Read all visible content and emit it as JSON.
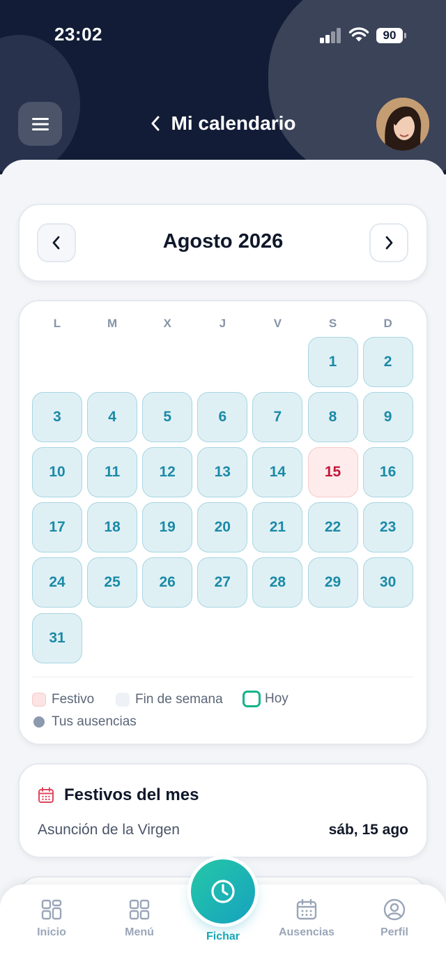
{
  "status_bar": {
    "time": "23:02",
    "battery": "90"
  },
  "header": {
    "title": "Mi calendario"
  },
  "calendar": {
    "month_label": "Agosto 2026",
    "weekdays": [
      "L",
      "M",
      "X",
      "J",
      "V",
      "S",
      "D"
    ],
    "first_weekday_index": 5,
    "days_in_month": 31,
    "holidays": [
      15
    ]
  },
  "legend": {
    "festivo": "Festivo",
    "fin_de_semana": "Fin de semana",
    "hoy": "Hoy",
    "ausencias": "Tus ausencias"
  },
  "festivos": {
    "title": "Festivos del mes",
    "items": [
      {
        "name": "Asunción de la Virgen",
        "date": "sáb, 15 ago"
      }
    ]
  },
  "bottom_nav": {
    "tabs": [
      {
        "label": "Inicio",
        "icon": "grid-icon"
      },
      {
        "label": "Menú",
        "icon": "menu-grid-icon"
      },
      {
        "label": "Fichar",
        "icon": "clock-icon",
        "active": true
      },
      {
        "label": "Ausencias",
        "icon": "calendar-icon"
      },
      {
        "label": "Perfil",
        "icon": "user-circle-icon"
      }
    ]
  },
  "colors": {
    "accent": "#16a7b4",
    "holiday": "#c6143a",
    "header_bg": "#121c36"
  }
}
